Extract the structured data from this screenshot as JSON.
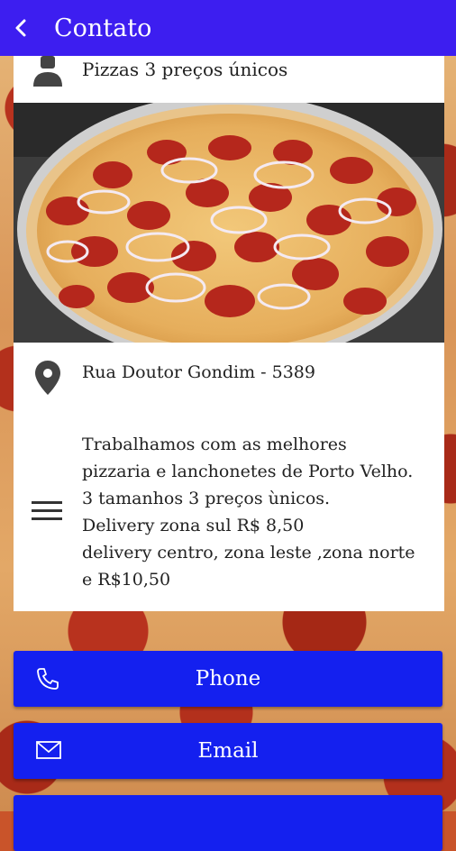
{
  "header": {
    "title": "Contato"
  },
  "card": {
    "name": "Pizzas 3 preços únicos",
    "address": "Rua Doutor Gondim - 5389",
    "description": "Trabalhamos com as melhores\npizzaria e lanchonetes de Porto Velho.\n3 tamanhos 3 preços ùnicos.\nDelivery zona sul R$ 8,50\ndelivery centro, zona leste ,zona norte\ne R$10,50"
  },
  "buttons": {
    "phone": "Phone",
    "email": "Email"
  },
  "icons": {
    "back": "back-arrow-icon",
    "person": "person-icon",
    "location": "location-pin-icon",
    "menu": "menu-lines-icon",
    "phone": "phone-icon",
    "email": "envelope-icon"
  },
  "colors": {
    "header": "#3d1ef0",
    "button": "#1420ef"
  }
}
